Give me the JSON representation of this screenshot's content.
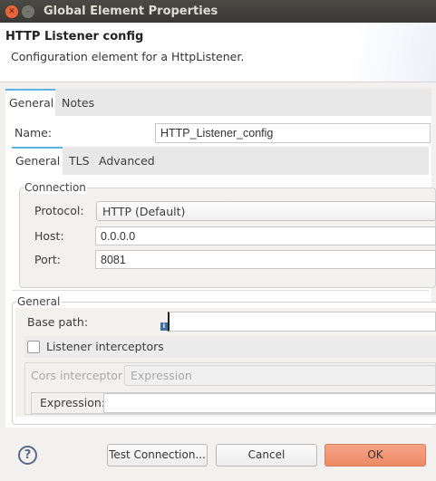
{
  "window": {
    "title": "Global Element Properties"
  },
  "header": {
    "title": "HTTP Listener config",
    "description": "Configuration element for a HttpListener."
  },
  "outer_tabs": [
    {
      "label": "General"
    },
    {
      "label": "Notes"
    }
  ],
  "name": {
    "label": "Name:",
    "value": "HTTP_Listener_config"
  },
  "inner_tabs": [
    {
      "label": "General"
    },
    {
      "label": "TLS"
    },
    {
      "label": "Advanced"
    }
  ],
  "connection": {
    "legend": "Connection",
    "protocol_label": "Protocol:",
    "protocol_value": "HTTP (Default)",
    "host_label": "Host:",
    "host_value": "0.0.0.0",
    "port_label": "Port:",
    "port_value": "8081"
  },
  "general": {
    "legend": "General",
    "base_path_label": "Base path:",
    "base_path_value": "",
    "listener_interceptors_label": "Listener interceptors",
    "listener_interceptors_checked": false,
    "cors_label": "Cors interceptor",
    "cors_value": "Expression",
    "expression_label": "Expression:",
    "expression_value": ""
  },
  "buttons": {
    "help": "?",
    "test": "Test Connection...",
    "cancel": "Cancel",
    "ok": "OK"
  },
  "colors": {
    "accent": "#5fb3e4",
    "ok": "#f0906e"
  }
}
